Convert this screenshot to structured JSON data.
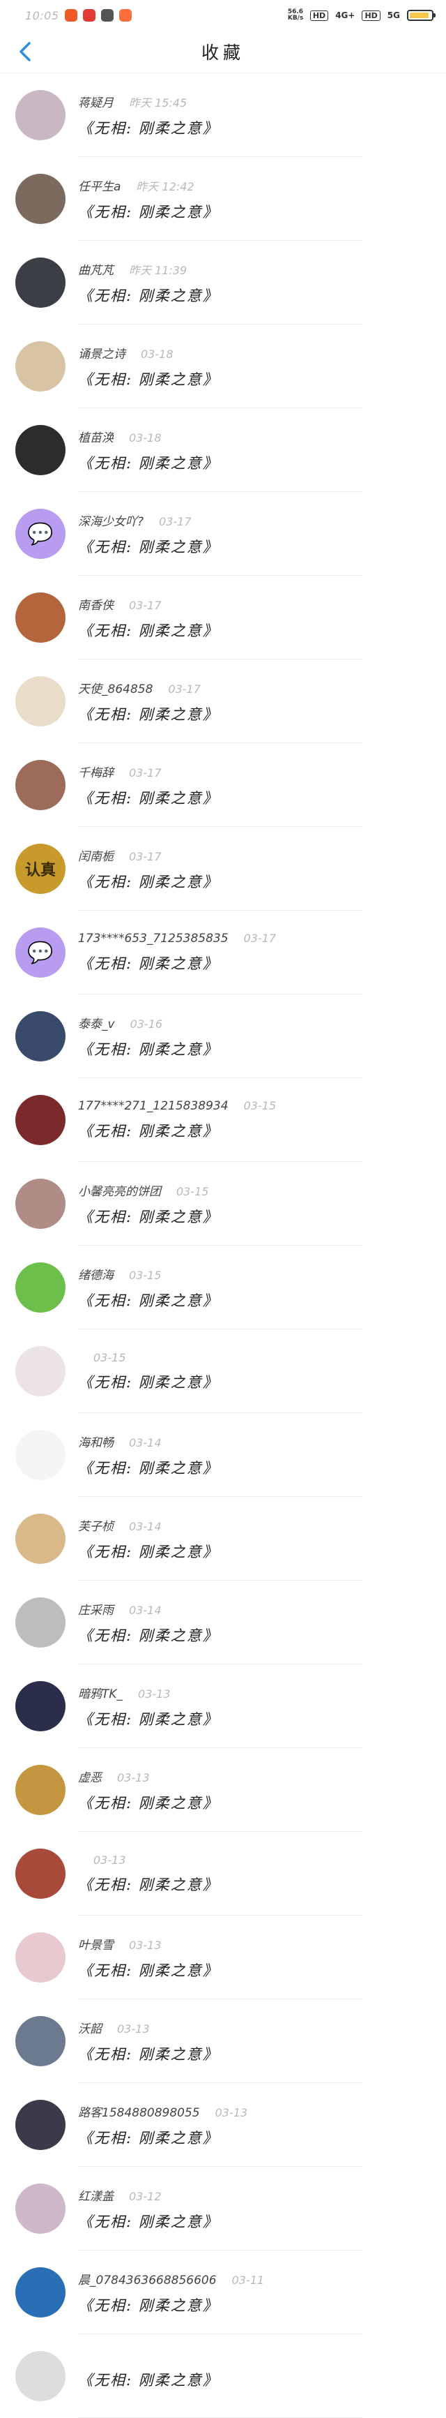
{
  "status": {
    "time": "10:05",
    "net_speed": "56.6 KB/s",
    "hd1": "HD",
    "signal1": "4G+",
    "hd2": "HD",
    "signal2": "5G",
    "battery_level": 0.9,
    "app_colors": [
      "#f05a28",
      "#e53935",
      "#555555",
      "#ff6f3c"
    ]
  },
  "header": {
    "title": "收藏",
    "back_icon": "chevron-left-icon",
    "accent": "#2f8de4"
  },
  "book_title": "《无相: 刚柔之意》",
  "items": [
    {
      "name": "蒋疑月",
      "time": "昨天 15:45",
      "color": "#c9b7c4",
      "glyph": ""
    },
    {
      "name": "任平生a",
      "time": "昨天 12:42",
      "color": "#7d6a5e",
      "glyph": ""
    },
    {
      "name": "曲芃芃",
      "time": "昨天 11:39",
      "color": "#3b3f45",
      "glyph": ""
    },
    {
      "name": "诵景之诗",
      "time": "03-18",
      "color": "#d8c3a5",
      "glyph": ""
    },
    {
      "name": "植苗涣",
      "time": "03-18",
      "color": "#2c2c2c",
      "glyph": ""
    },
    {
      "name": "深海少女吖?",
      "time": "03-17",
      "color": "#b89cf0",
      "glyph": "💬"
    },
    {
      "name": "南香侠",
      "time": "03-17",
      "color": "#b5653c",
      "glyph": ""
    },
    {
      "name": "天使_864858",
      "time": "03-17",
      "color": "#e9dcc8",
      "glyph": ""
    },
    {
      "name": "千梅辞",
      "time": "03-17",
      "color": "#9c6b5a",
      "glyph": ""
    },
    {
      "name": "闰南栀",
      "time": "03-17",
      "color": "#c79a2b",
      "glyph": "认真"
    },
    {
      "name": "173****653_7125385835",
      "time": "03-17",
      "color": "#b89cf0",
      "glyph": "💬"
    },
    {
      "name": "泰泰_v",
      "time": "03-16",
      "color": "#3a4a6b",
      "glyph": ""
    },
    {
      "name": "177****271_1215838934",
      "time": "03-15",
      "color": "#7a2a2a",
      "glyph": ""
    },
    {
      "name": "小馨亮亮的饼团",
      "time": "03-15",
      "color": "#b08c86",
      "glyph": ""
    },
    {
      "name": "绪德海",
      "time": "03-15",
      "color": "#6cbf4a",
      "glyph": ""
    },
    {
      "name": "",
      "time": "03-15",
      "color": "#ebe3e6",
      "glyph": ""
    },
    {
      "name": "海和畅",
      "time": "03-14",
      "color": "#f5f5f5",
      "glyph": ""
    },
    {
      "name": "芙子桢",
      "time": "03-14",
      "color": "#d9b98a",
      "glyph": ""
    },
    {
      "name": "庄采雨",
      "time": "03-14",
      "color": "#bdbdbd",
      "glyph": ""
    },
    {
      "name": "暗鸦TK_",
      "time": "03-13",
      "color": "#2a2e4a",
      "glyph": ""
    },
    {
      "name": "虚恶",
      "time": "03-13",
      "color": "#c4963f",
      "glyph": ""
    },
    {
      "name": "",
      "time": "03-13",
      "color": "#a84a3a",
      "glyph": ""
    },
    {
      "name": "叶景雪",
      "time": "03-13",
      "color": "#e8c9cf",
      "glyph": ""
    },
    {
      "name": "沃韶",
      "time": "03-13",
      "color": "#6b7a8f",
      "glyph": ""
    },
    {
      "name": "路客1584880898055",
      "time": "03-13",
      "color": "#3a3a4a",
      "glyph": ""
    },
    {
      "name": "红漾盖",
      "time": "03-12",
      "color": "#cdb7c8",
      "glyph": ""
    },
    {
      "name": "晨_0784363668856606",
      "time": "03-11",
      "color": "#2a6fb5",
      "glyph": ""
    },
    {
      "name": "",
      "time": "",
      "color": "#dddddd",
      "glyph": ""
    }
  ]
}
